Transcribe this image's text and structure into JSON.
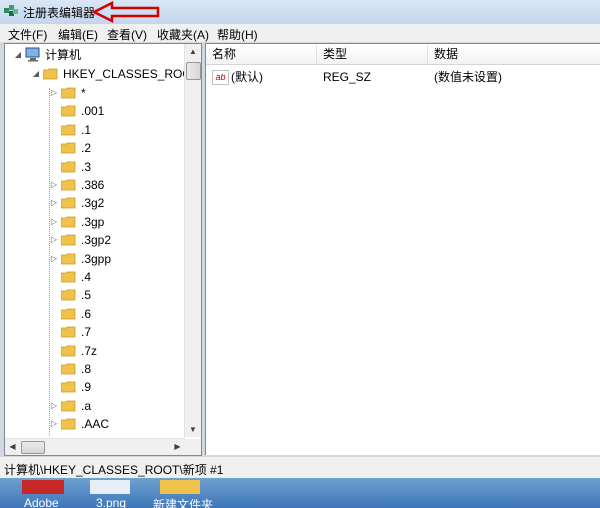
{
  "window": {
    "title": "注册表编辑器"
  },
  "menu": [
    "文件(F)",
    "编辑(E)",
    "查看(V)",
    "收藏夹(A)",
    "帮助(H)"
  ],
  "tree": {
    "root": "计算机",
    "hive": "HKEY_CLASSES_ROOT",
    "items": [
      {
        "label": "*",
        "expandable": true
      },
      {
        "label": ".001",
        "expandable": false
      },
      {
        "label": ".1",
        "expandable": false
      },
      {
        "label": ".2",
        "expandable": false
      },
      {
        "label": ".3",
        "expandable": false
      },
      {
        "label": ".386",
        "expandable": true
      },
      {
        "label": ".3g2",
        "expandable": true
      },
      {
        "label": ".3gp",
        "expandable": true
      },
      {
        "label": ".3gp2",
        "expandable": true
      },
      {
        "label": ".3gpp",
        "expandable": true
      },
      {
        "label": ".4",
        "expandable": false
      },
      {
        "label": ".5",
        "expandable": false
      },
      {
        "label": ".6",
        "expandable": false
      },
      {
        "label": ".7",
        "expandable": false
      },
      {
        "label": ".7z",
        "expandable": false
      },
      {
        "label": ".8",
        "expandable": false
      },
      {
        "label": ".9",
        "expandable": false
      },
      {
        "label": ".a",
        "expandable": true
      },
      {
        "label": ".AAC",
        "expandable": true
      }
    ]
  },
  "list": {
    "columns": [
      "名称",
      "类型",
      "数据"
    ],
    "rows": [
      {
        "name": "(默认)",
        "type": "REG_SZ",
        "data": "(数值未设置)",
        "icon": "string-value-icon"
      }
    ]
  },
  "status": {
    "path": "计算机\\HKEY_CLASSES_ROOT\\新项 #1"
  },
  "desktop": {
    "labels": [
      "Adobe",
      "3.png",
      "新建文件夹"
    ]
  },
  "colors": {
    "annotation_arrow": "#d40000",
    "folder": "#f0c24a"
  }
}
